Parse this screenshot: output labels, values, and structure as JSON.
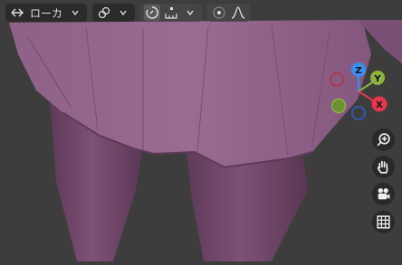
{
  "header": {
    "orientation_label": "ローカ",
    "icons": [
      "transform-pivot-icon",
      "snap-icon",
      "proportional-edit-icon",
      "falloff-icon"
    ]
  },
  "gizmo": {
    "axes": {
      "z": "Z",
      "y": "Y",
      "x": "X"
    },
    "colors": {
      "x": "#e6364f",
      "y": "#8bb33d",
      "z": "#3b8ef0"
    }
  },
  "nav_buttons": [
    "zoom-icon",
    "pan-hand-icon",
    "camera-icon",
    "grid-icon"
  ],
  "colors": {
    "background": "#3d3d3d",
    "mesh": "#8a5a82",
    "mesh_dark": "#6b4265",
    "header_bg": "#282828"
  }
}
